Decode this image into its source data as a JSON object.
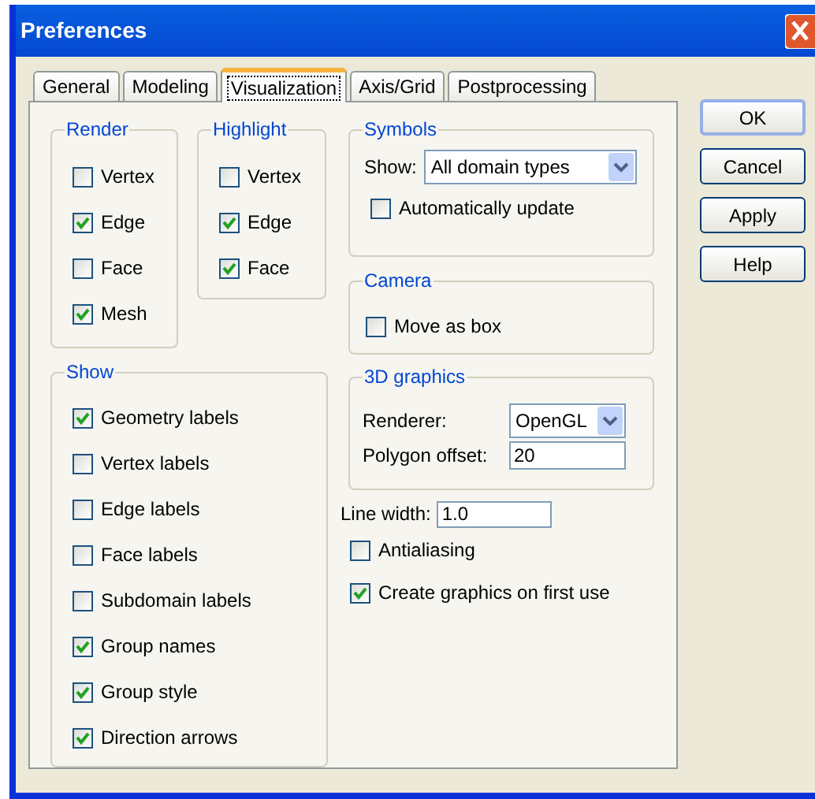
{
  "window": {
    "title": "Preferences"
  },
  "tabs": [
    {
      "label": "General",
      "selected": false
    },
    {
      "label": "Modeling",
      "selected": false
    },
    {
      "label": "Visualization",
      "selected": true
    },
    {
      "label": "Axis/Grid",
      "selected": false
    },
    {
      "label": "Postprocessing",
      "selected": false
    }
  ],
  "render": {
    "title": "Render",
    "items": [
      {
        "label": "Vertex",
        "checked": false
      },
      {
        "label": "Edge",
        "checked": true
      },
      {
        "label": "Face",
        "checked": false
      },
      {
        "label": "Mesh",
        "checked": true
      }
    ]
  },
  "highlight": {
    "title": "Highlight",
    "items": [
      {
        "label": "Vertex",
        "checked": false
      },
      {
        "label": "Edge",
        "checked": true
      },
      {
        "label": "Face",
        "checked": true
      }
    ]
  },
  "show": {
    "title": "Show",
    "items": [
      {
        "label": "Geometry labels",
        "checked": true
      },
      {
        "label": "Vertex labels",
        "checked": false
      },
      {
        "label": "Edge labels",
        "checked": false
      },
      {
        "label": "Face labels",
        "checked": false
      },
      {
        "label": "Subdomain labels",
        "checked": false
      },
      {
        "label": "Group names",
        "checked": true
      },
      {
        "label": "Group style",
        "checked": true
      },
      {
        "label": "Direction arrows",
        "checked": true
      }
    ]
  },
  "symbols": {
    "title": "Symbols",
    "show_label": "Show:",
    "show_value": "All domain types",
    "auto_update": {
      "label": "Automatically update",
      "checked": false
    }
  },
  "camera": {
    "title": "Camera",
    "move_as_box": {
      "label": "Move as box",
      "checked": false
    }
  },
  "graphics": {
    "title": "3D graphics",
    "renderer_label": "Renderer:",
    "renderer_value": "OpenGL",
    "offset_label": "Polygon offset:",
    "offset_value": "20"
  },
  "line_width": {
    "label": "Line width:",
    "value": "1.0"
  },
  "options": [
    {
      "label": "Antialiasing",
      "checked": false
    },
    {
      "label": "Create graphics on first use",
      "checked": true
    }
  ],
  "buttons": [
    "OK",
    "Cancel",
    "Apply",
    "Help"
  ]
}
